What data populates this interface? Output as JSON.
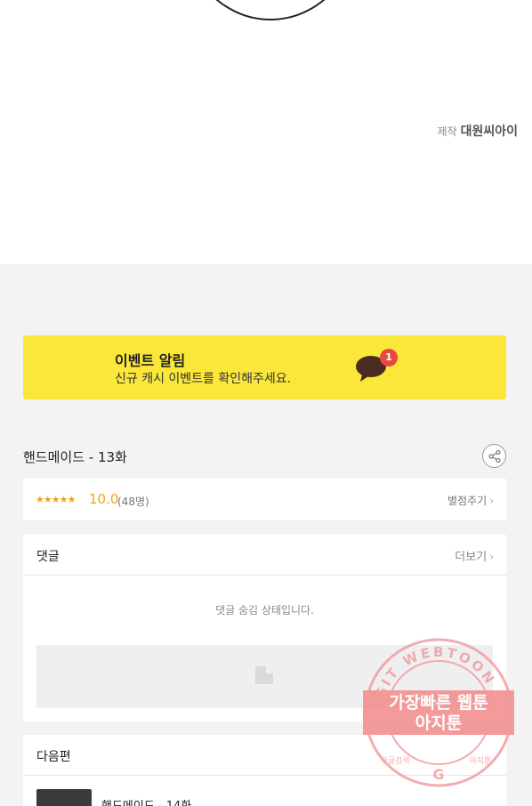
{
  "credit": {
    "prefix": "제작",
    "studio": "대원씨아이"
  },
  "event": {
    "title": "이벤트 알림",
    "subtitle": "신규 캐시 이벤트를 확인해주세요.",
    "badge_count": "1",
    "accent": "#fbe63a"
  },
  "episode": {
    "title": "핸드메이드 - 13화"
  },
  "rating": {
    "stars": "★★★★★",
    "score": "10.0",
    "count": "(48명)",
    "rate_label": "별점주기"
  },
  "comments": {
    "title": "댓글",
    "more_label": "더보기",
    "hidden_message": "댓글 숨김 상태입니다."
  },
  "next": {
    "title": "다음편",
    "episode_title": "핸드메이드 - 14화"
  },
  "watermark": {
    "arc_text": "AGIT WEBTOON",
    "line1": "가장빠른 웹툰",
    "line2": "아지툰",
    "left_small": "구글검색",
    "right_small": "아지툰"
  }
}
